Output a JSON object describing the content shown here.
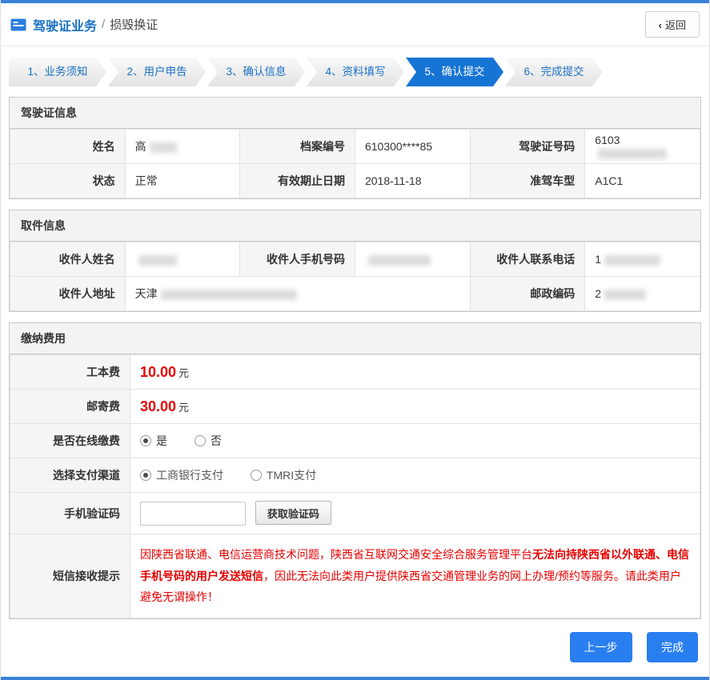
{
  "header": {
    "title": "驾驶证业务",
    "separator": "/",
    "subtitle": "损毁换证",
    "back_chevron": "‹",
    "back_label": "返回"
  },
  "steps": {
    "active_index": 4,
    "items": [
      {
        "label": "1、业务须知"
      },
      {
        "label": "2、用户申告"
      },
      {
        "label": "3、确认信息"
      },
      {
        "label": "4、资料填写"
      },
      {
        "label": "5、确认提交"
      },
      {
        "label": "6、完成提交"
      }
    ]
  },
  "license": {
    "title": "驾驶证信息",
    "name_label": "姓名",
    "name_value": "高",
    "file_no_label": "档案编号",
    "file_no_value": "610300****85",
    "license_no_label": "驾驶证号码",
    "license_no_value": "6103",
    "status_label": "状态",
    "status_value": "正常",
    "expiry_label": "有效期止日期",
    "expiry_value": "2018-11-18",
    "vehicle_class_label": "准驾车型",
    "vehicle_class_value": "A1C1"
  },
  "pickup": {
    "title": "取件信息",
    "recipient_name_label": "收件人姓名",
    "recipient_name_value": "",
    "recipient_mobile_label": "收件人手机号码",
    "recipient_mobile_value": "",
    "recipient_phone_label": "收件人联系电话",
    "recipient_phone_value": "1",
    "address_label": "收件人地址",
    "address_value": "天津",
    "postcode_label": "邮政编码",
    "postcode_value": "2"
  },
  "payment": {
    "title": "缴纳费用",
    "work_fee_label": "工本费",
    "work_fee_value": "10.00",
    "work_fee_unit": "元",
    "mail_fee_label": "邮寄费",
    "mail_fee_value": "30.00",
    "mail_fee_unit": "元",
    "online_pay_label": "是否在线缴费",
    "online_pay_options": [
      {
        "label": "是",
        "selected": true
      },
      {
        "label": "否",
        "selected": false
      }
    ],
    "channel_label": "选择支付渠道",
    "channel_options": [
      {
        "label": "工商银行支付",
        "selected": true
      },
      {
        "label": "TMRI支付",
        "selected": false
      }
    ],
    "sms_code_label": "手机验证码",
    "sms_code_value": "",
    "get_code_button": "获取验证码",
    "sms_tip_label": "短信接收提示",
    "sms_tip_part1": "因陕西省联通、电信运营商技术问题，陕西省互联网交通安全综合服务管理平台",
    "sms_tip_part2": "无法向持陕西省以外联通、电信手机号码的用户发送短信",
    "sms_tip_part3": "，因此无法向此类用户提供陕西省交通管理业务的网上办理/预约等服务。请此类用户避免无谓操作！"
  },
  "footer": {
    "prev_button": "上一步",
    "finish_button": "完成"
  }
}
